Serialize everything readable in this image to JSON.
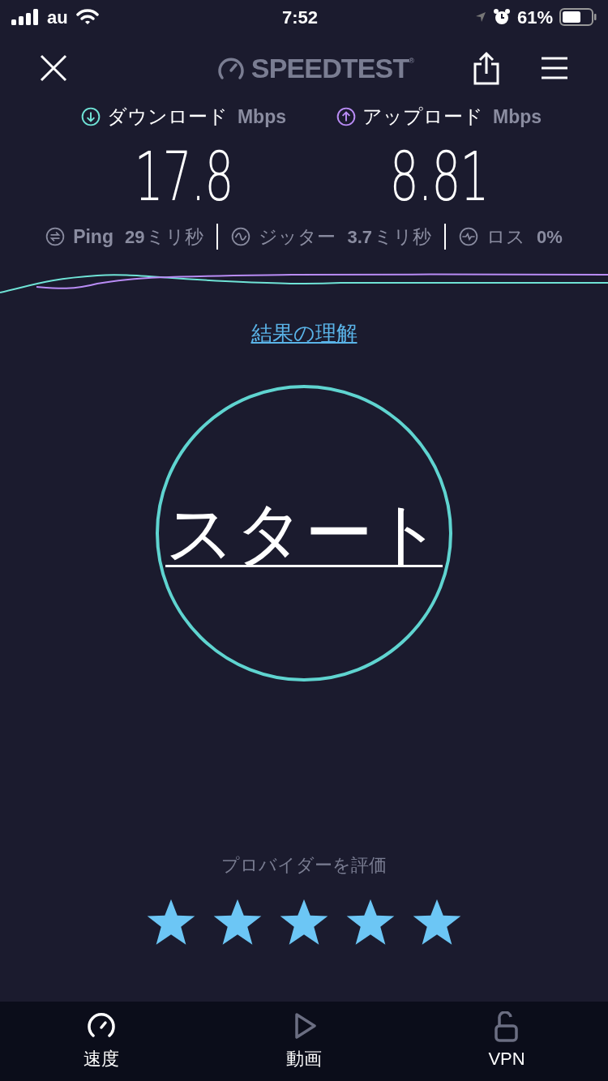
{
  "status_bar": {
    "carrier": "au",
    "time": "7:52",
    "battery": "61%"
  },
  "header": {
    "logo": "SPEEDTEST$^{®}$"
  },
  "metrics": [
    {
      "kind": "download",
      "label": "ダウンロード",
      "unit": "Mbps",
      "value": "17.8",
      "color": "#6fe3d6"
    },
    {
      "kind": "upload",
      "label": "アップロード",
      "unit": "Mbps",
      "value": "8.81",
      "color": "#b98cf5"
    }
  ],
  "stats": [
    {
      "kind": "ping",
      "label": "Ping",
      "value": "29",
      "unit": "ミリ秒"
    },
    {
      "kind": "jitter",
      "label": "ジッター",
      "value": "3.7",
      "unit": "ミリ秒"
    },
    {
      "kind": "loss",
      "label": "ロス",
      "value": "0%"
    }
  ],
  "results_link": "結果の理解",
  "start_button": "スタート",
  "rating": {
    "label": "プロバイダーを評価",
    "stars": 5
  },
  "tabs": [
    {
      "kind": "speed",
      "label": "速度",
      "selected": true
    },
    {
      "kind": "video",
      "label": "動画",
      "selected": false
    },
    {
      "kind": "vpn",
      "label": "VPN",
      "selected": false
    }
  ]
}
